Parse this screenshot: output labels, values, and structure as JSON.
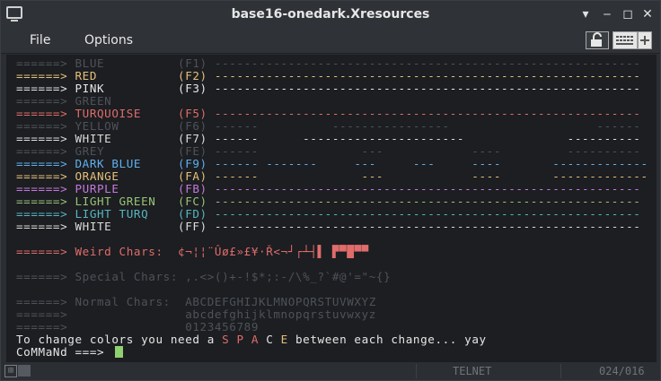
{
  "window": {
    "title": "base16-onedark.Xresources"
  },
  "menu": {
    "file": "File",
    "options": "Options"
  },
  "status": {
    "protocol": "TELNET",
    "position": "024/016"
  },
  "colors": {
    "grey": "#4e5259",
    "red": "#e06c6c",
    "pink": "#e6e6e6",
    "white": "#dcdcdc",
    "darkblue": "#61afef",
    "orange": "#e5c07b",
    "purple": "#c678dd",
    "lightgreen": "#98c379",
    "lightturq": "#56b6c2",
    "cursor": "#8fd072"
  },
  "icons": [
    "app-window-icon",
    "minimize-icon",
    "maximize-icon",
    "close-icon",
    "lock-icon",
    "keypad-icon",
    "keyboard-icon"
  ],
  "terminal": {
    "lines": [
      {
        "t": "======> BLUE          (F1) ----------------------------------------------------------",
        "c": "grey"
      },
      {
        "t": "======> RED           (F2) ----------------------------------------------------------",
        "c": "orange"
      },
      {
        "t": "======> PINK          (F3) ----------------------------------------------------------",
        "c": "pink"
      },
      {
        "t": "======> GREEN",
        "c": "grey"
      },
      {
        "t": "======> TURQUOISE     (F5) ----------------------------------------------------------",
        "c": "red"
      },
      {
        "t": "======> YELLOW        (F6) ------          ----------------                    ------",
        "c": "grey"
      },
      {
        "t": "======> WHITE         (F7) ------      ----------------------              ----------",
        "c": "white"
      },
      {
        "t": "======> GREY          (FE) ------              ---            ----         ----------",
        "c": "grey"
      },
      {
        "t": "======> DARK BLUE     (F9) ------ -------     ---     ---     ----       -------------",
        "c": "darkblue"
      },
      {
        "t": "======> ORANGE        (FA) ------              ---            ----       -------------",
        "c": "orange"
      },
      {
        "t": "======> PURPLE        (FB) ----------------------------------------------------------",
        "c": "purple"
      },
      {
        "t": "======> LIGHT GREEN   (FC) ----------------------------------------------------------",
        "c": "lightgreen"
      },
      {
        "t": "======> LIGHT TURQ    (FD) ----------------------------------------------------------",
        "c": "lightturq"
      },
      {
        "t": "======> WHITE         (FF) ----------------------------------------------------------",
        "c": "white"
      },
      {
        "t": "",
        "c": "white"
      },
      {
        "t": "======> Weird Chars:  ¢¬¦¦¨Ûø£»£¥·Ř<¬┘┌┴┤▌ ▛▀█▀▀",
        "c": "red"
      },
      {
        "t": "",
        "c": "white"
      },
      {
        "t": "======> Special Chars: ,.<>()+-!$*;:-/\\%_?`#@'=\"~{}",
        "c": "grey"
      },
      {
        "t": "",
        "c": "white"
      },
      {
        "t": "======> Normal Chars:  ABCDEFGHIJKLMNOPQRSTUVWXYZ",
        "c": "grey"
      },
      {
        "t": "======>                abcdefghijklmnopqrstuvwxyz",
        "c": "grey"
      },
      {
        "t": "======>                0123456789",
        "c": "grey"
      }
    ],
    "change_prefix": "To change colors you need a ",
    "space_s": "S",
    "space_p": "P",
    "space_a": "A",
    "space_c": "C",
    "space_e": "E",
    "change_suffix": " between each change... yay",
    "prompt": "CoMMaNd ===>"
  }
}
